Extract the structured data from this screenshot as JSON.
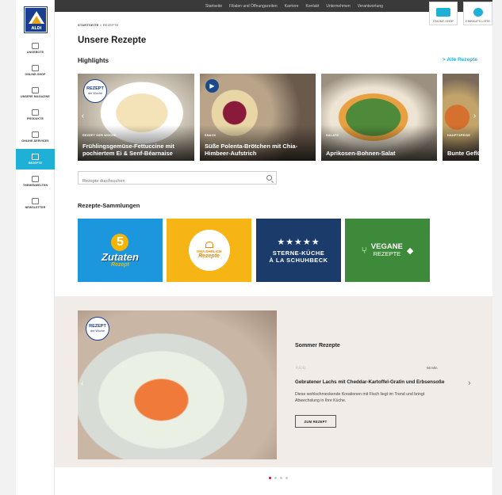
{
  "sidebar": {
    "logo_text": "ALDI",
    "items": [
      {
        "label": "ANGEBOTE",
        "icon": "tag-icon"
      },
      {
        "label": "ONLINE-SHOP",
        "icon": "truck-icon"
      },
      {
        "label": "UNSERE MAGAZINE",
        "icon": "magazine-icon"
      },
      {
        "label": "PRODUKTE",
        "icon": "product-icon"
      },
      {
        "label": "ONLINE-SERVICES",
        "icon": "services-icon"
      },
      {
        "label": "REZEPTE",
        "icon": "recipe-icon"
      },
      {
        "label": "THEMENWELTEN",
        "icon": "themes-icon"
      },
      {
        "label": "NEWSLETTER",
        "icon": "mail-icon"
      }
    ]
  },
  "topbar": {
    "links": [
      "Startseite",
      "Filialen und Öffnungszeiten",
      "Karriere",
      "Kontakt",
      "Unternehmen",
      "Verantwortung"
    ],
    "online_shop": "ONLINE-SHOP",
    "einkaufsliste": "EINKAUFS-LISTE"
  },
  "breadcrumb": {
    "home": "STARTSEITE",
    "sep": ">",
    "current": "REZEPTE"
  },
  "page_title": "Unsere Rezepte",
  "highlights": {
    "heading": "Highlights",
    "all_link": "> Alle Rezepte",
    "badge_main": "REZEPT",
    "badge_sub": "der Woche",
    "cards": [
      {
        "category": "REZEPT DER WOCHE",
        "title": "Frühlingsgemüse-Fettuccine mit pochiertem Ei & Senf-Béarnaise",
        "time": ""
      },
      {
        "category": "SNACK",
        "title": "Süße Polenta-Brötchen mit Chia-Himbeer-Aufstrich",
        "time": ""
      },
      {
        "category": "SALATE",
        "title": "Aprikosen-Bohnen-Salat",
        "time": ""
      },
      {
        "category": "HAUPTSPEISE",
        "title": "Bunte Geflügel (all in one)",
        "time": ""
      }
    ]
  },
  "search": {
    "placeholder": "Rezepte durchsuchen"
  },
  "collections": {
    "heading": "Rezepte-Sammlungen",
    "tiles": [
      {
        "line1": "5",
        "line2": "Zutaten",
        "line3": "Rezept"
      },
      {
        "line1": "OMA EHRLICH",
        "line2": "Rezepte"
      },
      {
        "line1": "STERNE-KÜCHE",
        "line2": "À LA SCHUHBECK"
      },
      {
        "line1": "VEGANE",
        "line2": "REZEPTE"
      }
    ]
  },
  "featured": {
    "section_title": "Sommer Rezepte",
    "time": "95 Min",
    "recipe_title": "Gebratener Lachs mit Cheddar-Kartoffel-Gratin und Erbsensoße",
    "description": "Diese wohlschmeckende Kreationen mit Fisch liegt im Trend und bringt Abwechslung in Ihre Küche.",
    "button": "ZUM REZEPT",
    "badge_main": "REZEPT",
    "badge_sub": "der Woche"
  },
  "colors": {
    "accent": "#1fb0d8",
    "brand": "#1a3d8f",
    "dot_active": "#e2001a"
  }
}
